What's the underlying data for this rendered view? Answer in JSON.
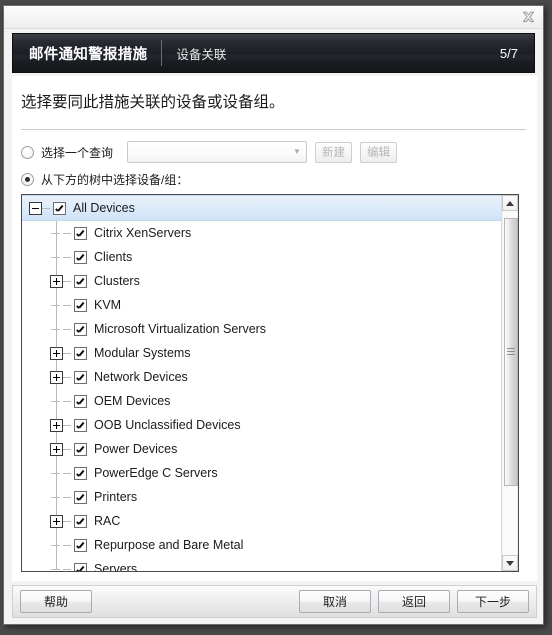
{
  "window": {
    "close_icon": "close-icon"
  },
  "banner": {
    "title": "邮件通知警报措施",
    "subtitle": "设备关联",
    "step": "5/7"
  },
  "main": {
    "instruction": "选择要同此措施关联的设备或设备组。",
    "query_option": {
      "label": "选择一个查询",
      "selected": false,
      "select_value": "",
      "select_placeholder": "",
      "new_button": "新建",
      "edit_button": "编辑",
      "buttons_disabled": true
    },
    "tree_option": {
      "label": "从下方的树中选择设备/组：",
      "selected": true
    }
  },
  "tree": {
    "nodes": [
      {
        "label": "All Devices",
        "level": 0,
        "expander": "minus",
        "checked": true,
        "selected": true
      },
      {
        "label": "Citrix XenServers",
        "level": 1,
        "expander": "none",
        "checked": true,
        "selected": false
      },
      {
        "label": "Clients",
        "level": 1,
        "expander": "none",
        "checked": true,
        "selected": false
      },
      {
        "label": "Clusters",
        "level": 1,
        "expander": "plus",
        "checked": true,
        "selected": false
      },
      {
        "label": "KVM",
        "level": 1,
        "expander": "none",
        "checked": true,
        "selected": false
      },
      {
        "label": "Microsoft Virtualization Servers",
        "level": 1,
        "expander": "none",
        "checked": true,
        "selected": false
      },
      {
        "label": "Modular Systems",
        "level": 1,
        "expander": "plus",
        "checked": true,
        "selected": false
      },
      {
        "label": "Network Devices",
        "level": 1,
        "expander": "plus",
        "checked": true,
        "selected": false
      },
      {
        "label": "OEM Devices",
        "level": 1,
        "expander": "none",
        "checked": true,
        "selected": false
      },
      {
        "label": "OOB Unclassified Devices",
        "level": 1,
        "expander": "plus",
        "checked": true,
        "selected": false
      },
      {
        "label": "Power Devices",
        "level": 1,
        "expander": "plus",
        "checked": true,
        "selected": false
      },
      {
        "label": "PowerEdge C Servers",
        "level": 1,
        "expander": "none",
        "checked": true,
        "selected": false
      },
      {
        "label": "Printers",
        "level": 1,
        "expander": "none",
        "checked": true,
        "selected": false
      },
      {
        "label": "RAC",
        "level": 1,
        "expander": "plus",
        "checked": true,
        "selected": false
      },
      {
        "label": "Repurpose and Bare Metal",
        "level": 1,
        "expander": "none",
        "checked": true,
        "selected": false
      },
      {
        "label": "Servers",
        "level": 1,
        "expander": "none",
        "checked": true,
        "selected": false
      }
    ],
    "scrollbar": {
      "thumb_top_pct": 2,
      "thumb_height_pct": 78
    }
  },
  "footer": {
    "help": "帮助",
    "cancel": "取消",
    "back": "返回",
    "next": "下一步"
  }
}
